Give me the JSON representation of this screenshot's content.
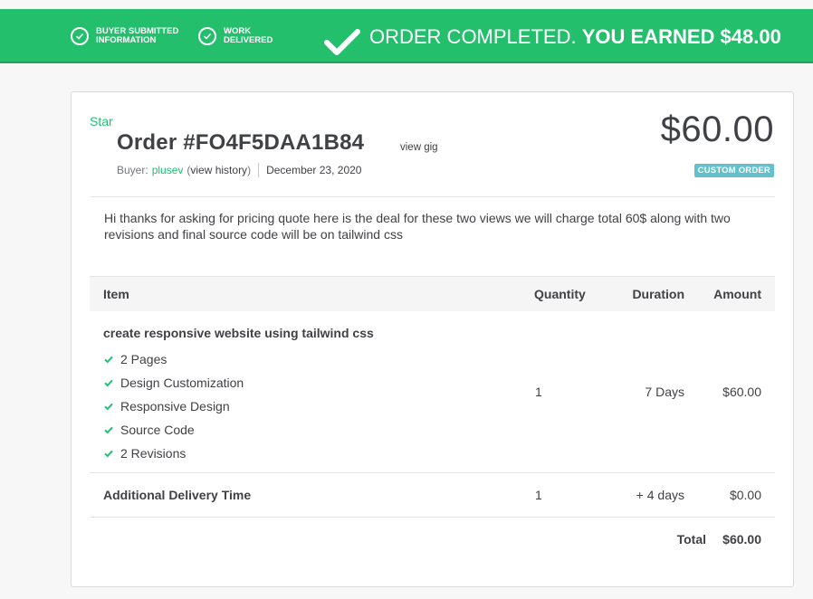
{
  "banner": {
    "steps": [
      {
        "label": "BUYER SUBMITTED\nINFORMATION",
        "icon": "check-circle-icon"
      },
      {
        "label": "WORK\nDELIVERED",
        "icon": "check-circle-icon"
      }
    ],
    "title": "ORDER COMPLETED.",
    "earned": "YOU EARNED $48.00",
    "color": "#24bf6c"
  },
  "order": {
    "star_label": "Star",
    "title": "Order #FO4F5DAA1B84",
    "view_gig": "view gig",
    "buyer_prefix": "Buyer:",
    "buyer_name": "plusev",
    "view_history_open": "(",
    "view_history": "view history",
    "view_history_close": ")",
    "date": "December 23, 2020",
    "price": "$60.00",
    "badge": "CUSTOM ORDER",
    "description": "Hi thanks for asking for pricing quote here is the deal for these two views we will charge total 60$ along with two revisions and final source code will be on tailwind css"
  },
  "table": {
    "headers": {
      "item": "Item",
      "quantity": "Quantity",
      "duration": "Duration",
      "amount": "Amount"
    },
    "main_row": {
      "title": "create responsive website using tailwind css",
      "features": [
        "2 Pages",
        "Design Customization",
        "Responsive Design",
        "Source Code",
        "2 Revisions"
      ],
      "quantity": "1",
      "duration": "7 Days",
      "amount": "$60.00"
    },
    "extra_row": {
      "label": "Additional Delivery Time",
      "quantity": "1",
      "duration": "+ 4 days",
      "amount": "$0.00"
    },
    "total_label": "Total",
    "total_value": "$60.00"
  }
}
